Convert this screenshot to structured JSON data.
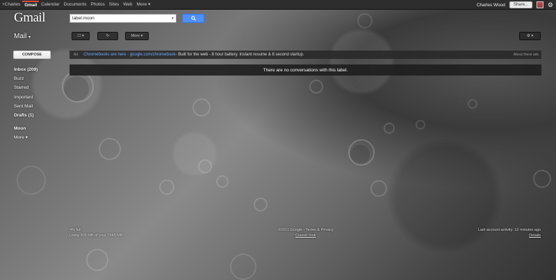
{
  "topbar": {
    "nav": [
      "+Charles",
      "Gmail",
      "Calendar",
      "Documents",
      "Photos",
      "Sites",
      "Web",
      "More ▾"
    ],
    "user": "Charles Wood",
    "share_label": "Share..."
  },
  "logo": "Gmail",
  "search": {
    "value": "label:moon",
    "button_icon": "search-icon"
  },
  "mail_label": "Mail",
  "toolbar": {
    "more_label": "More ▾"
  },
  "compose_label": "COMPOSE",
  "sidebar": {
    "items": [
      {
        "label": "Inbox (209)"
      },
      {
        "label": "Buzz"
      },
      {
        "label": "Starred"
      },
      {
        "label": "Important"
      },
      {
        "label": "Sent Mail"
      },
      {
        "label": "Drafts (1)"
      },
      {
        "label": "Moon"
      },
      {
        "label": "More ▾"
      }
    ]
  },
  "notice": {
    "ad": "Ad",
    "link": "Chromebooks are here - google.com/chromebook",
    "message": " - Built for the web - 8 hour battery. Instant resume & 8 second startup.",
    "about": "About these ads"
  },
  "empty_message": "There are no conversations with this label.",
  "footer": {
    "usage_percent": "4% full",
    "usage_detail": "Using 306 MB of your 7645 MB",
    "copyright": "©2011 Google - Terms & Privacy",
    "classic": "Classic look",
    "activity": "Last account activity: 12 minutes ago",
    "details": "Details"
  }
}
